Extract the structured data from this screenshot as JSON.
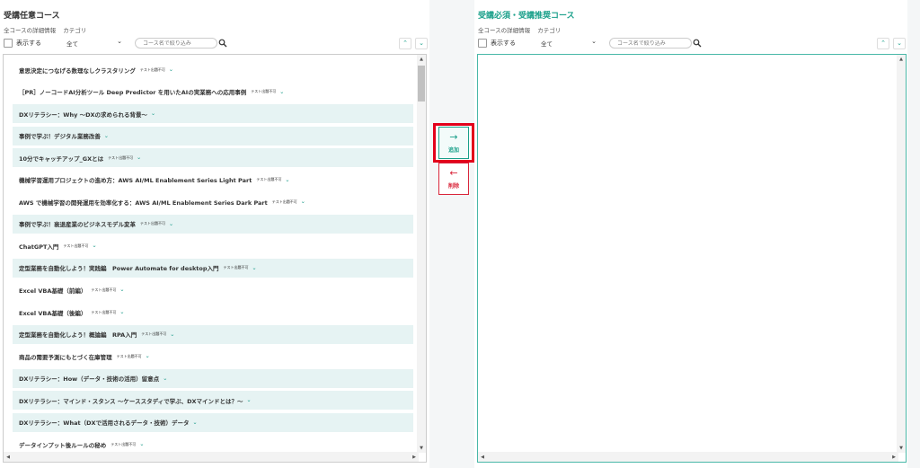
{
  "left": {
    "title": "受講任意コース",
    "sublinks": [
      "全コースの詳細情報",
      "カテゴリ"
    ],
    "show_label": "表示する",
    "filter_value": "全て",
    "search_placeholder": "コース名で絞り込み",
    "items": [
      {
        "title": "意思決定につなげる数理なしクラスタリング",
        "badge": "テスト出題不可",
        "alt": false
      },
      {
        "title": "［PR］ノーコードAI分析ツール Deep Predictor を用いたAIの実業務への応用事例",
        "badge": "テスト出題不可",
        "alt": false
      },
      {
        "title": "DXリテラシー：Why ～DXの求められる背景～",
        "badge": "",
        "alt": true
      },
      {
        "title": "事例で学ぶ！デジタル業務改善",
        "badge": "",
        "alt": true
      },
      {
        "title": "10分でキャッチアップ_GXとは",
        "badge": "テスト出題不可",
        "alt": true
      },
      {
        "title": "機械学習運用プロジェクトの進め方：AWS AI/ML Enablement Series Light Part",
        "badge": "テスト出題不可",
        "alt": false
      },
      {
        "title": "AWS で機械学習の開発運用を効率化する：AWS AI/ML Enablement Series Dark Part",
        "badge": "テスト出題不可",
        "alt": false
      },
      {
        "title": "事例で学ぶ！衰退産業のビジネスモデル変革",
        "badge": "テスト出題不可",
        "alt": true
      },
      {
        "title": "ChatGPT入門",
        "badge": "テスト出題不可",
        "alt": false
      },
      {
        "title": "定型業務を自動化しよう！実践編　Power Automate for desktop入門",
        "badge": "テスト出題不可",
        "alt": true
      },
      {
        "title": "Excel VBA基礎（前編）",
        "badge": "テスト出題不可",
        "alt": false
      },
      {
        "title": "Excel VBA基礎（後編）",
        "badge": "テスト出題不可",
        "alt": false
      },
      {
        "title": "定型業務を自動化しよう！概論編　RPA入門",
        "badge": "テスト出題不可",
        "alt": true
      },
      {
        "title": "商品の需要予測にもとづく在庫管理",
        "badge": "テスト出題不可",
        "alt": false
      },
      {
        "title": "DXリテラシー：How（データ・技術の活用）留意点",
        "badge": "",
        "alt": true
      },
      {
        "title": "DXリテラシー：マインド・スタンス ～ケーススタディで学ぶ、DXマインドとは？～",
        "badge": "",
        "alt": true
      },
      {
        "title": "DXリテラシー：What（DXで活用されるデータ・技術）データ",
        "badge": "",
        "alt": true
      },
      {
        "title": "データインプット後ルールの秘め",
        "badge": "テスト出題不可",
        "alt": false
      }
    ]
  },
  "right": {
    "title": "受講必須・受講推奨コース",
    "sublinks": [
      "全コースの詳細情報",
      "カテゴリ"
    ],
    "show_label": "表示する",
    "filter_value": "全て",
    "search_placeholder": "コース名で絞り込み"
  },
  "transfer": {
    "add_label": "追加",
    "remove_label": "削除"
  },
  "colors": {
    "accent": "#1aa08a",
    "highlight_border": "#e3001b",
    "remove": "#d9263b",
    "row_alt": "#e6f3f3"
  }
}
